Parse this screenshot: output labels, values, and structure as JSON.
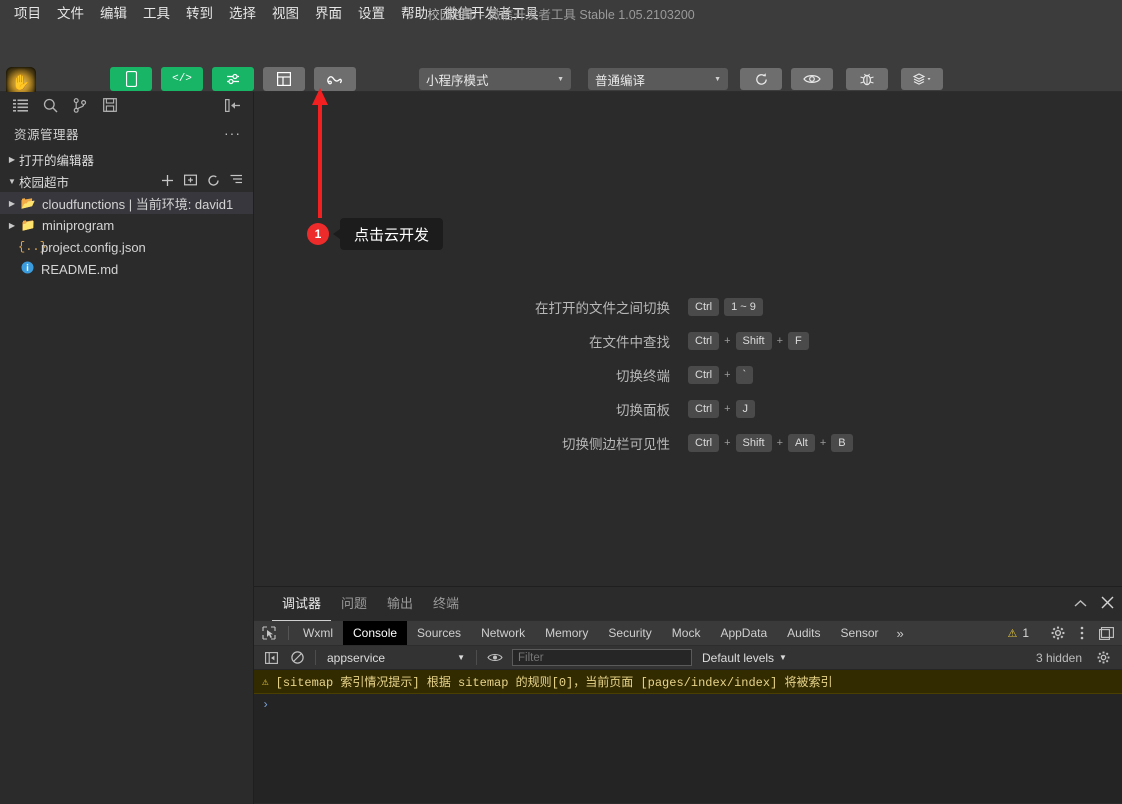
{
  "titlebar": {
    "menus": [
      "项目",
      "文件",
      "编辑",
      "工具",
      "转到",
      "选择",
      "视图",
      "界面",
      "设置",
      "帮助",
      "微信开发者工具"
    ],
    "project_name": "校园超市",
    "app_title": "- 微信开发者工具 Stable 1.05.2103200"
  },
  "toolbar": {
    "mode_buttons": [
      {
        "label": "模拟器",
        "icon": "phone-icon",
        "style": "green"
      },
      {
        "label": "编辑器",
        "icon": "code-icon",
        "style": "green"
      },
      {
        "label": "调试器",
        "icon": "sliders-icon",
        "style": "green"
      },
      {
        "label": "可视化",
        "icon": "layout-icon",
        "style": "grey"
      },
      {
        "label": "云开发",
        "icon": "cloud-dev-icon",
        "style": "grey"
      }
    ],
    "mode_select": "小程序模式",
    "compile_select": "普通编译",
    "action_buttons": [
      {
        "label": "编译",
        "icon": "refresh-icon"
      },
      {
        "label": "预览",
        "icon": "eye-icon"
      },
      {
        "label": "真机调试",
        "icon": "bug-icon"
      },
      {
        "label": "清缓存",
        "icon": "layers-icon"
      }
    ]
  },
  "sidebar": {
    "activity_icons": [
      "explorer-icon",
      "search-icon",
      "source-control-icon",
      "save-icon"
    ],
    "collapse_icon": "collapse-sidebar-icon",
    "explorer_title": "资源管理器",
    "more_actions": "···",
    "sections": [
      {
        "label": "打开的编辑器",
        "expanded": false
      },
      {
        "label": "校园超市",
        "expanded": true
      }
    ],
    "section_action_icons": [
      "new-file-icon",
      "new-folder-icon",
      "refresh-icon",
      "collapse-all-icon"
    ],
    "tree": [
      {
        "label": "cloudfunctions | 当前环境: david1",
        "icon": "folder-open-icon",
        "type": "folder",
        "selected": true,
        "expandable": true
      },
      {
        "label": "miniprogram",
        "icon": "folder-icon",
        "type": "folder",
        "selected": false,
        "expandable": true
      },
      {
        "label": "project.config.json",
        "icon": "json-icon",
        "type": "file",
        "selected": false,
        "expandable": false
      },
      {
        "label": "README.md",
        "icon": "markdown-icon",
        "type": "file",
        "selected": false,
        "expandable": false
      }
    ]
  },
  "editor": {
    "shortcuts": [
      {
        "label": "在打开的文件之间切换",
        "keys": [
          "Ctrl",
          "1 ~ 9"
        ],
        "separators": [
          ""
        ]
      },
      {
        "label": "在文件中查找",
        "keys": [
          "Ctrl",
          "Shift",
          "F"
        ],
        "separators": [
          "+",
          "+"
        ]
      },
      {
        "label": "切换终端",
        "keys": [
          "Ctrl",
          "`"
        ],
        "separators": [
          "+"
        ]
      },
      {
        "label": "切换面板",
        "keys": [
          "Ctrl",
          "J"
        ],
        "separators": [
          "+"
        ]
      },
      {
        "label": "切换侧边栏可见性",
        "keys": [
          "Ctrl",
          "Shift",
          "Alt",
          "B"
        ],
        "separators": [
          "+",
          "+",
          "+"
        ]
      }
    ]
  },
  "annotation": {
    "badge": "1",
    "text": "点击云开发",
    "color": "#ee2b2b"
  },
  "panel": {
    "tabs": [
      {
        "label": "调试器",
        "active": true
      },
      {
        "label": "问题",
        "active": false
      },
      {
        "label": "输出",
        "active": false
      },
      {
        "label": "终端",
        "active": false
      }
    ],
    "collapse_icon": "chevron-up-icon",
    "close_icon": "close-icon",
    "devtools_tabs": [
      {
        "label": "Wxml",
        "active": false
      },
      {
        "label": "Console",
        "active": true
      },
      {
        "label": "Sources",
        "active": false
      },
      {
        "label": "Network",
        "active": false
      },
      {
        "label": "Memory",
        "active": false
      },
      {
        "label": "Security",
        "active": false
      },
      {
        "label": "Mock",
        "active": false
      },
      {
        "label": "AppData",
        "active": false
      },
      {
        "label": "Audits",
        "active": false
      },
      {
        "label": "Sensor",
        "active": false
      }
    ],
    "devtools_more": "»",
    "warning_count": "1",
    "console": {
      "context": "appservice",
      "filter_placeholder": "Filter",
      "filter_value": "",
      "levels": "Default levels",
      "hidden_count": "3 hidden",
      "messages": [
        {
          "type": "warning",
          "text": "[sitemap 索引情况提示] 根据 sitemap 的规则[0]，当前页面 [pages/index/index] 将被索引"
        }
      ],
      "prompt": "›"
    }
  }
}
